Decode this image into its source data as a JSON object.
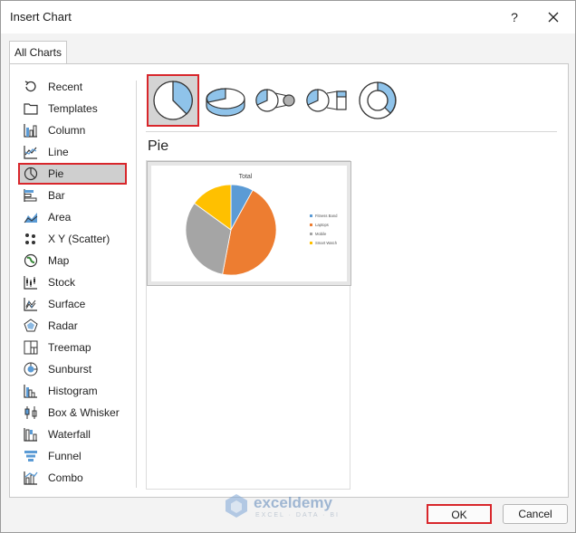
{
  "window": {
    "title": "Insert Chart",
    "help": "?"
  },
  "tabs": [
    {
      "label": "All Charts"
    }
  ],
  "sidebar": {
    "items": [
      {
        "label": "Recent",
        "icon": "recent-icon"
      },
      {
        "label": "Templates",
        "icon": "templates-icon"
      },
      {
        "label": "Column",
        "icon": "column-chart-icon"
      },
      {
        "label": "Line",
        "icon": "line-chart-icon"
      },
      {
        "label": "Pie",
        "icon": "pie-chart-icon"
      },
      {
        "label": "Bar",
        "icon": "bar-chart-icon"
      },
      {
        "label": "Area",
        "icon": "area-chart-icon"
      },
      {
        "label": "X Y (Scatter)",
        "icon": "scatter-chart-icon"
      },
      {
        "label": "Map",
        "icon": "map-chart-icon"
      },
      {
        "label": "Stock",
        "icon": "stock-chart-icon"
      },
      {
        "label": "Surface",
        "icon": "surface-chart-icon"
      },
      {
        "label": "Radar",
        "icon": "radar-chart-icon"
      },
      {
        "label": "Treemap",
        "icon": "treemap-chart-icon"
      },
      {
        "label": "Sunburst",
        "icon": "sunburst-chart-icon"
      },
      {
        "label": "Histogram",
        "icon": "histogram-chart-icon"
      },
      {
        "label": "Box & Whisker",
        "icon": "box-whisker-chart-icon"
      },
      {
        "label": "Waterfall",
        "icon": "waterfall-chart-icon"
      },
      {
        "label": "Funnel",
        "icon": "funnel-chart-icon"
      },
      {
        "label": "Combo",
        "icon": "combo-chart-icon"
      }
    ],
    "selected": "Pie"
  },
  "subtypes": [
    {
      "icon": "pie-subtype-icon",
      "selected": true
    },
    {
      "icon": "3d-pie-subtype-icon",
      "selected": false
    },
    {
      "icon": "pie-of-pie-subtype-icon",
      "selected": false
    },
    {
      "icon": "bar-of-pie-subtype-icon",
      "selected": false
    },
    {
      "icon": "doughnut-subtype-icon",
      "selected": false
    }
  ],
  "section": {
    "title": "Pie"
  },
  "chart_data": {
    "type": "pie",
    "title": "Total",
    "categories": [
      "Fitness Band",
      "Laptops",
      "Mobile",
      "Smart Watch"
    ],
    "values": [
      8,
      45,
      32,
      15
    ],
    "colors": [
      "#5b9bd5",
      "#ed7d31",
      "#a5a5a5",
      "#ffc000"
    ],
    "legend": "right"
  },
  "watermark": {
    "name": "exceldemy",
    "sub": "EXCEL · DATA · BI"
  },
  "footer": {
    "ok": "OK",
    "cancel": "Cancel"
  },
  "accent": "#d8262b"
}
